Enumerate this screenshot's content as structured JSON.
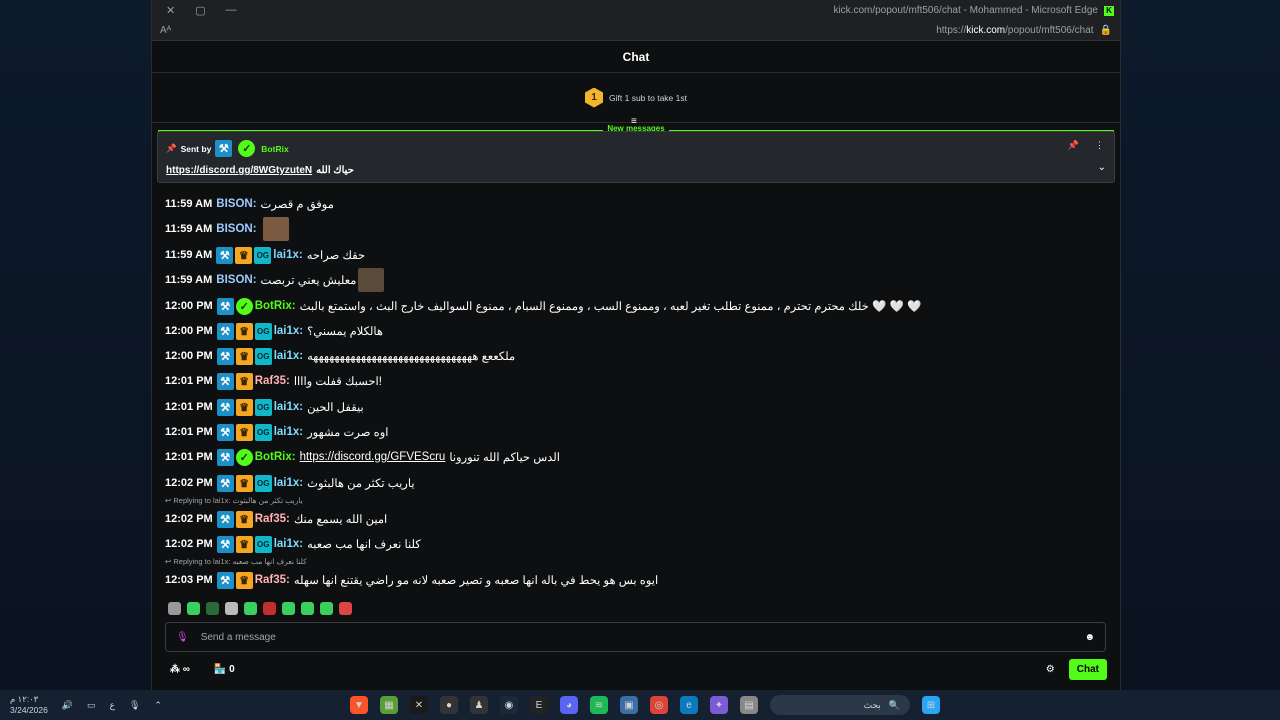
{
  "browser": {
    "title": "kick.com/popout/mft506/chat - Mohammed - Microsoft Edge",
    "url_prefix": "https://",
    "url_domain": "kick.com",
    "url_path": "/popout/mft506/chat",
    "reader_label": "Aᴬ"
  },
  "chat": {
    "header": "Chat",
    "gift_rank": "1",
    "gift_text": "Gift 1 sub to take 1st",
    "new_messages": "New messages",
    "pinned": {
      "sent_by_label": "Sent by",
      "user": "BotRix",
      "link": "https://discord.gg/8WGtyzuteN",
      "text": "حياك الله"
    },
    "messages": [
      {
        "time": "11:59 AM",
        "user": "BISON",
        "color": "#9ecbff",
        "badges": [],
        "text": "موفق م قصرت"
      },
      {
        "time": "11:59 AM",
        "user": "BISON",
        "color": "#9ecbff",
        "badges": [],
        "text": "",
        "emote": true
      },
      {
        "time": "11:59 AM",
        "user": "lai1x",
        "color": "#7fdcff",
        "badges": [
          "mod",
          "crown",
          "og"
        ],
        "text": "حقك صراحه"
      },
      {
        "time": "11:59 AM",
        "user": "BISON",
        "color": "#9ecbff",
        "badges": [],
        "text": "معليش يعني تربصت",
        "emote": true
      },
      {
        "time": "12:00 PM",
        "user": "BotRix",
        "color": "#53fc18",
        "badges": [
          "mod",
          "bot"
        ],
        "text": "خلك محترم تحترم ، ممنوع تطلب تغير لعبه ، وممنوع السب ، وممنوع السبام ، ممنوع السواليف خارج البث ، واستمتع بالبث 🤍 🤍 🤍"
      },
      {
        "time": "12:00 PM",
        "user": "lai1x",
        "color": "#7fdcff",
        "badges": [
          "mod",
          "crown",
          "og"
        ],
        "text": "هالكلام يمسني؟"
      },
      {
        "time": "12:00 PM",
        "user": "lai1x",
        "color": "#7fdcff",
        "badges": [
          "mod",
          "crown",
          "og"
        ],
        "text": "ملكععع هههههههههههههههههههههههههههههههه"
      },
      {
        "time": "12:01 PM",
        "user": "Raf35",
        "color": "#ffb3b3",
        "badges": [
          "mod",
          "crown"
        ],
        "text": "احسبك قفلت واااا!"
      },
      {
        "time": "12:01 PM",
        "user": "lai1x",
        "color": "#7fdcff",
        "badges": [
          "mod",
          "crown",
          "og"
        ],
        "text": "بيقفل الحين"
      },
      {
        "time": "12:01 PM",
        "user": "lai1x",
        "color": "#7fdcff",
        "badges": [
          "mod",
          "crown",
          "og"
        ],
        "text": "اوه صرت مشهور"
      },
      {
        "time": "12:01 PM",
        "user": "BotRix",
        "color": "#53fc18",
        "badges": [
          "mod",
          "bot"
        ],
        "text": "الدس حياكم الله تنورونا",
        "link": "https://discord.gg/GFVEScru"
      },
      {
        "time": "12:02 PM",
        "user": "lai1x",
        "color": "#7fdcff",
        "badges": [
          "mod",
          "crown",
          "og"
        ],
        "text": "ياريب تكثر من هالبثوث"
      },
      {
        "time": "12:02 PM",
        "user": "Raf35",
        "color": "#ffb3b3",
        "badges": [
          "mod",
          "crown"
        ],
        "text": "امين الله يسمع منك",
        "reply": "Replying to lai1x: ياريب تكثر من هالبثوث"
      },
      {
        "time": "12:02 PM",
        "user": "lai1x",
        "color": "#7fdcff",
        "badges": [
          "mod",
          "crown",
          "og"
        ],
        "text": "كلنا نعرف انها مب صعبه"
      },
      {
        "time": "12:03 PM",
        "user": "Raf35",
        "color": "#ffb3b3",
        "badges": [
          "mod",
          "crown"
        ],
        "text": "ايوه بس هو يحط في باله انها صعبه و تصير صعبه لانه مو راضي يقتنع انها سهله",
        "reply": "Replying to lai1x: كلنا نعرف انها مب صعبه"
      }
    ],
    "input_placeholder": "Send a message",
    "points": "∞",
    "store_count": "0",
    "chat_button": "Chat"
  },
  "taskbar": {
    "time": "١٢:٠٣ م",
    "date": "3/24/2026",
    "lang": "ع",
    "search_placeholder": "بحث"
  }
}
